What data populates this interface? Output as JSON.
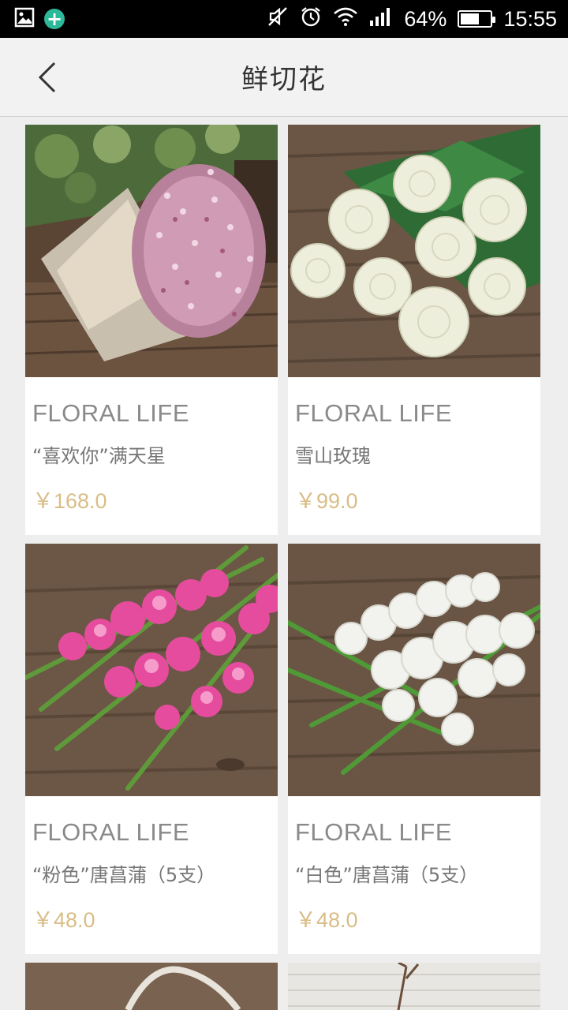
{
  "status_bar": {
    "battery": "64%",
    "battery_level": 0.64,
    "time": "15:55",
    "icons": [
      "gallery-icon",
      "plus-circle-icon",
      "mute-icon",
      "alarm-icon",
      "wifi-icon",
      "signal-icon",
      "battery-icon"
    ]
  },
  "nav": {
    "title": "鲜切花",
    "back_icon": "chevron-left-icon"
  },
  "products": [
    {
      "brand": "FLORAL LIFE",
      "name": "“喜欢你”满天星",
      "price": "￥168.0",
      "image": "pink-babys-breath-bouquet"
    },
    {
      "brand": "FLORAL LIFE",
      "name": "雪山玫瑰",
      "price": "￥99.0",
      "image": "white-roses"
    },
    {
      "brand": "FLORAL LIFE",
      "name": "“粉色”唐菖蒲（5支）",
      "price": "￥48.0",
      "image": "pink-gladiolus"
    },
    {
      "brand": "FLORAL LIFE",
      "name": "“白色”唐菖蒲（5支）",
      "price": "￥48.0",
      "image": "white-gladiolus"
    }
  ],
  "colors": {
    "price": "#d9bd86",
    "brand_text": "#8a8a8a",
    "page_bg": "#eeeeee",
    "nav_bg": "#f2f2f2"
  }
}
